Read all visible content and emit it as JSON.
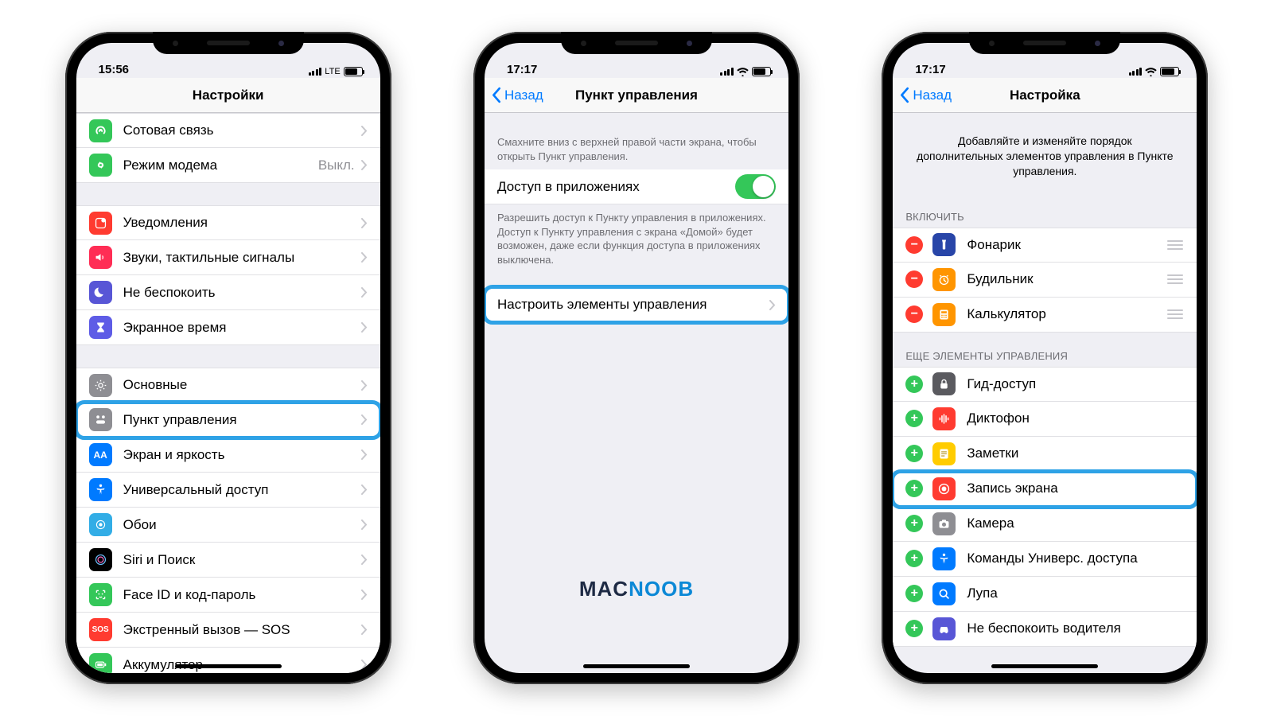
{
  "watermark": {
    "a": "MAC",
    "b": "NOOB"
  },
  "phone1": {
    "time": "15:56",
    "net": "LTE",
    "title": "Настройки",
    "rows": [
      {
        "icon": "antenna-icon",
        "bg": "ic-green",
        "label": "Сотовая связь"
      },
      {
        "icon": "link-icon",
        "bg": "ic-green2",
        "label": "Режим модема",
        "sub": "Выкл."
      },
      {
        "icon": "notif-icon",
        "bg": "ic-red",
        "label": "Уведомления",
        "groupStart": true
      },
      {
        "icon": "sound-icon",
        "bg": "ic-pink",
        "label": "Звуки, тактильные сигналы"
      },
      {
        "icon": "moon-icon",
        "bg": "ic-purple",
        "label": "Не беспокоить"
      },
      {
        "icon": "hourglass-icon",
        "bg": "ic-purple2",
        "label": "Экранное время"
      },
      {
        "icon": "gear-icon",
        "bg": "ic-gray",
        "label": "Основные",
        "groupStart": true
      },
      {
        "icon": "control-icon",
        "bg": "ic-gray",
        "label": "Пункт управления",
        "hilite": true
      },
      {
        "icon": "aa-icon",
        "bg": "ic-blue",
        "label": "Экран и яркость"
      },
      {
        "icon": "access-icon",
        "bg": "ic-blue",
        "label": "Универсальный доступ"
      },
      {
        "icon": "wallpaper-icon",
        "bg": "ic-cyan",
        "label": "Обои"
      },
      {
        "icon": "siri-icon",
        "bg": "ic-black",
        "label": "Siri и Поиск"
      },
      {
        "icon": "faceid-icon",
        "bg": "ic-green",
        "label": "Face ID и код-пароль"
      },
      {
        "icon": "sos-icon",
        "bg": "ic-red",
        "label": "Экстренный вызов — SOS",
        "sos": "SOS"
      },
      {
        "icon": "battery-icon",
        "bg": "ic-green",
        "label": "Аккумулятор"
      }
    ]
  },
  "phone2": {
    "time": "17:17",
    "back": "Назад",
    "title": "Пункт управления",
    "desc1": "Смахните вниз с верхней правой части экрана, чтобы открыть Пункт управления.",
    "row_access": "Доступ в приложениях",
    "desc2": "Разрешить доступ к Пункту управления в приложениях. Доступ к Пункту управления с экрана «Домой» будет возможен, даже если функция доступа в приложениях выключена.",
    "row_customize": "Настроить элементы управления"
  },
  "phone3": {
    "time": "17:17",
    "back": "Назад",
    "title": "Настройка",
    "intro": "Добавляйте и изменяйте порядок дополнительных элементов управления в Пункте управления.",
    "section1": "ВКЛЮЧИТЬ",
    "included": [
      {
        "icon": "flashlight-icon",
        "bg": "ic-darkblue",
        "label": "Фонарик"
      },
      {
        "icon": "alarm-icon",
        "bg": "ic-orange",
        "label": "Будильник"
      },
      {
        "icon": "calc-icon",
        "bg": "ic-orange",
        "label": "Калькулятор"
      }
    ],
    "section2": "ЕЩЕ ЭЛЕМЕНТЫ УПРАВЛЕНИЯ",
    "more": [
      {
        "icon": "lock-icon",
        "bg": "ic-dgrey",
        "label": "Гид-доступ"
      },
      {
        "icon": "voice-icon",
        "bg": "ic-red",
        "label": "Диктофон"
      },
      {
        "icon": "note-icon",
        "bg": "ic-yellow",
        "label": "Заметки"
      },
      {
        "icon": "record-icon",
        "bg": "ic-red",
        "label": "Запись экрана",
        "hilite": true
      },
      {
        "icon": "camera-icon",
        "bg": "ic-gray",
        "label": "Камера"
      },
      {
        "icon": "access2-icon",
        "bg": "ic-blue",
        "label": "Команды Универс. доступа"
      },
      {
        "icon": "magnifier-icon",
        "bg": "ic-blue",
        "label": "Лупа"
      },
      {
        "icon": "car-icon",
        "bg": "ic-purple",
        "label": "Не беспокоить водителя"
      }
    ]
  }
}
